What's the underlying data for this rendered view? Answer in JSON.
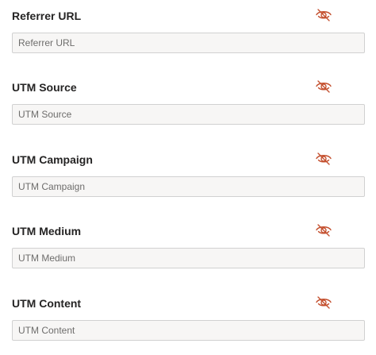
{
  "accent_color": "#c4502f",
  "fields": [
    {
      "label": "Referrer URL",
      "placeholder": "Referrer URL",
      "value": "",
      "icon": "eye-hidden-icon"
    },
    {
      "label": "UTM Source",
      "placeholder": "UTM Source",
      "value": "",
      "icon": "eye-hidden-icon"
    },
    {
      "label": "UTM Campaign",
      "placeholder": "UTM Campaign",
      "value": "",
      "icon": "eye-hidden-icon"
    },
    {
      "label": "UTM Medium",
      "placeholder": "UTM Medium",
      "value": "",
      "icon": "eye-hidden-icon"
    },
    {
      "label": "UTM Content",
      "placeholder": "UTM Content",
      "value": "",
      "icon": "eye-hidden-icon"
    }
  ]
}
